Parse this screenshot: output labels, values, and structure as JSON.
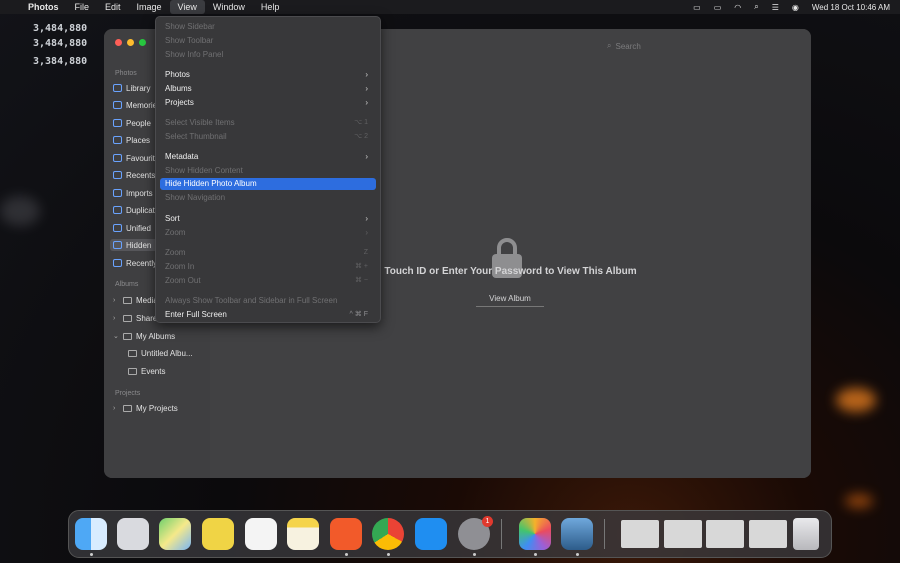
{
  "menubar": {
    "app_name": "Photos",
    "items": [
      "File",
      "Edit",
      "Image",
      "View",
      "Window",
      "Help"
    ],
    "datetime": "Wed 18 Oct  10:46 AM"
  },
  "desktop": {
    "numbers": [
      "3,484,880",
      "3,484,880",
      "3,384,880"
    ]
  },
  "window": {
    "search_placeholder": "Search",
    "sidebar": {
      "photos_header": "Photos",
      "items": [
        "Library",
        "Memories",
        "People",
        "Places",
        "Favourites",
        "Recents",
        "Imports",
        "Duplicates",
        "Unified",
        "Hidden",
        "Recently Deleted"
      ],
      "albums_header": "Albums",
      "album_items": [
        "Media Types",
        "Shared Albums",
        "My Albums"
      ],
      "my_albums_children": [
        "Untitled Albu...",
        "Events"
      ],
      "projects_header": "Projects",
      "project_items": [
        "My Projects"
      ]
    },
    "locked": {
      "message": "Touch ID or Enter Your Password to View This Album",
      "view_button": "View Album"
    }
  },
  "view_menu": {
    "items": [
      {
        "label": "Show Sidebar",
        "disabled": true
      },
      {
        "label": "Show Toolbar",
        "disabled": true
      },
      {
        "label": "Show Info Panel",
        "disabled": true
      },
      {
        "label": "Photos",
        "arrow": true
      },
      {
        "label": "Albums",
        "arrow": true
      },
      {
        "label": "Projects",
        "arrow": true
      },
      {
        "label": "Select Visible Items",
        "disabled": true,
        "shortcut": "⌥ 1"
      },
      {
        "label": "Select Thumbnail",
        "disabled": true,
        "shortcut": "⌥ 2"
      },
      {
        "label": "Metadata",
        "arrow": true
      },
      {
        "label": "Show Hidden Content",
        "disabled": true
      },
      {
        "label": "Hide Hidden Photo Album",
        "highlighted": true
      },
      {
        "label": "Show Navigation",
        "disabled": true
      },
      {
        "label": "Sort",
        "arrow": true
      },
      {
        "label": "Zoom",
        "arrow": true,
        "disabled": true
      },
      {
        "label": "Zoom",
        "disabled": true,
        "shortcut": "Z"
      },
      {
        "label": "Zoom In",
        "disabled": true,
        "shortcut": "⌘ +"
      },
      {
        "label": "Zoom Out",
        "disabled": true,
        "shortcut": "⌘ −"
      },
      {
        "label": "Always Show Toolbar and Sidebar in Full Screen",
        "disabled": true
      },
      {
        "label": "Enter Full Screen",
        "shortcut": "^ ⌘ F"
      }
    ]
  },
  "dock": {
    "apps": [
      "Finder",
      "Launchpad",
      "Maps",
      "Basecamp",
      "Reminders",
      "Notes",
      "Brave",
      "Chrome",
      "App Store",
      "System Settings",
      "Photos",
      "Preview"
    ],
    "settings_badge": "1"
  }
}
